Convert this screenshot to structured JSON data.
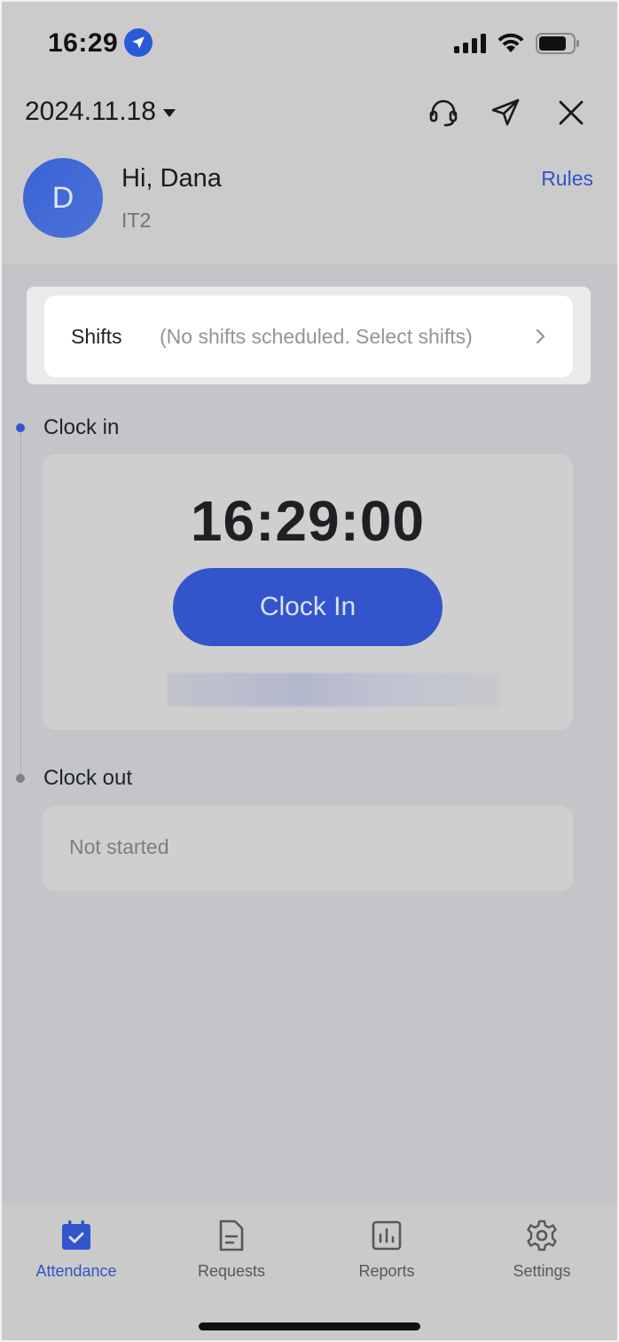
{
  "status_bar": {
    "time": "16:29"
  },
  "header": {
    "date": "2024.11.18",
    "greeting": "Hi, Dana",
    "department": "IT2",
    "avatar_letter": "D",
    "rules_label": "Rules"
  },
  "shifts": {
    "label": "Shifts",
    "value": "(No shifts scheduled. Select shifts)"
  },
  "clock_in": {
    "title": "Clock in",
    "time": "16:29:00",
    "button_label": "Clock In"
  },
  "clock_out": {
    "title": "Clock out",
    "status": "Not started"
  },
  "tabs": [
    {
      "label": "Attendance",
      "icon": "calendar-check-icon",
      "active": true
    },
    {
      "label": "Requests",
      "icon": "document-icon",
      "active": false
    },
    {
      "label": "Reports",
      "icon": "bar-chart-icon",
      "active": false
    },
    {
      "label": "Settings",
      "icon": "gear-icon",
      "active": false
    }
  ],
  "colors": {
    "accent": "#3355cc",
    "link": "#2f55c8",
    "overlay_gray": "#c4c5c8"
  }
}
